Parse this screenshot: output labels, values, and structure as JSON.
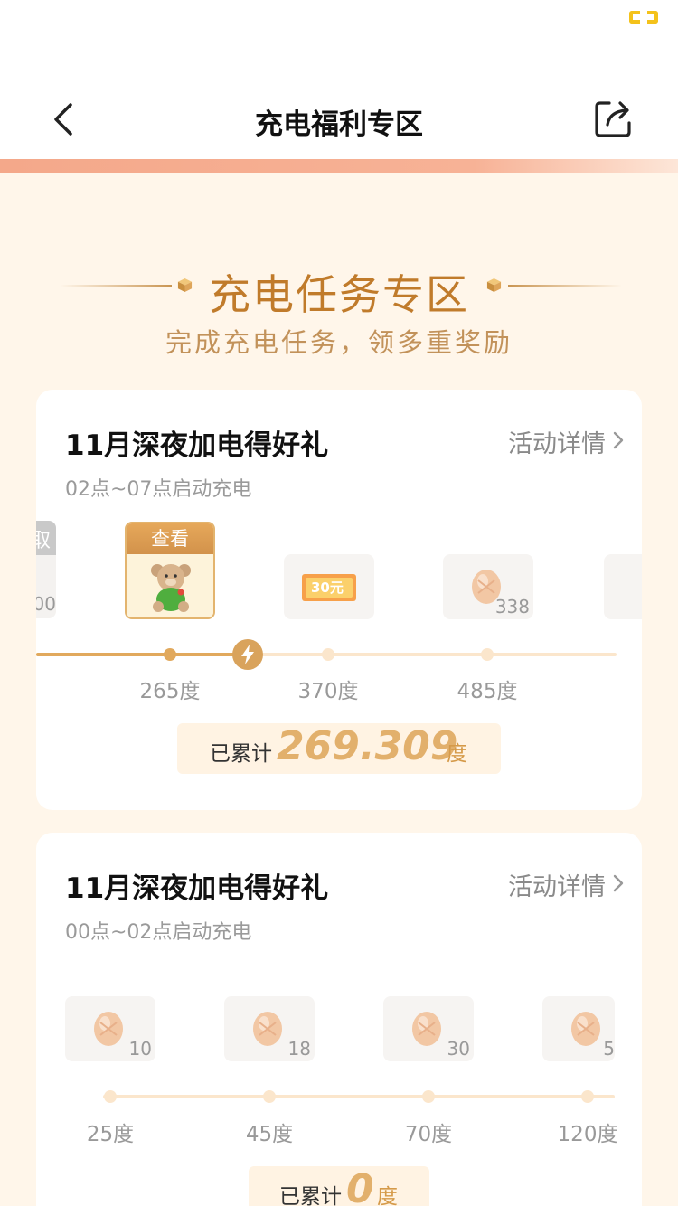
{
  "header": {
    "title": "充电福利专区"
  },
  "section": {
    "title": "充电任务专区",
    "subtitle": "完成充电任务，领多重奖励"
  },
  "cards": [
    {
      "title": "11月深夜加电得好礼",
      "detail_label": "活动详情",
      "time_range": "02点~07点启动充电",
      "partial_left_tag": "取",
      "partial_left_count": "00",
      "featured_tag": "查看",
      "rewards": [
        {
          "label": "30元",
          "icon": "coupon-icon"
        },
        {
          "count": "338",
          "icon": "egg-icon"
        }
      ],
      "milestones": [
        "265度",
        "370度",
        "485度"
      ],
      "total_label": "已累计",
      "total_value": "269.309",
      "total_unit": "度"
    },
    {
      "title": "11月深夜加电得好礼",
      "detail_label": "活动详情",
      "time_range": "00点~02点启动充电",
      "rewards": [
        {
          "count": "10",
          "icon": "egg-icon"
        },
        {
          "count": "18",
          "icon": "egg-icon"
        },
        {
          "count": "30",
          "icon": "egg-icon"
        },
        {
          "count": "5",
          "icon": "egg-icon"
        }
      ],
      "milestones": [
        "25度",
        "45度",
        "70度",
        "120度"
      ],
      "total_label": "已累计",
      "total_value": "0",
      "total_unit": "度"
    }
  ],
  "colors": {
    "accent": "#e1a95d",
    "heading": "#c07b2b",
    "background": "#fff6ea"
  }
}
